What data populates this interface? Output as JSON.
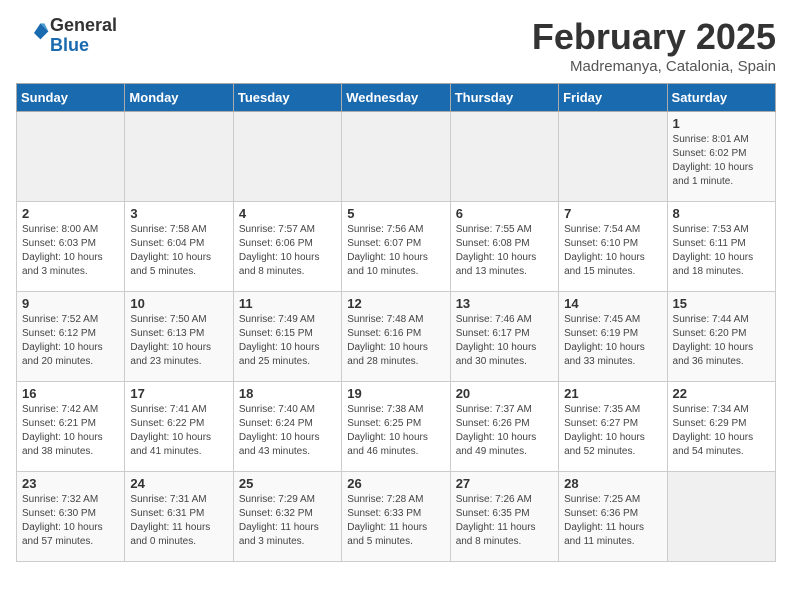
{
  "header": {
    "logo_line1": "General",
    "logo_line2": "Blue",
    "month_title": "February 2025",
    "location": "Madremanya, Catalonia, Spain"
  },
  "days_of_week": [
    "Sunday",
    "Monday",
    "Tuesday",
    "Wednesday",
    "Thursday",
    "Friday",
    "Saturday"
  ],
  "weeks": [
    [
      {
        "day": "",
        "info": ""
      },
      {
        "day": "",
        "info": ""
      },
      {
        "day": "",
        "info": ""
      },
      {
        "day": "",
        "info": ""
      },
      {
        "day": "",
        "info": ""
      },
      {
        "day": "",
        "info": ""
      },
      {
        "day": "1",
        "info": "Sunrise: 8:01 AM\nSunset: 6:02 PM\nDaylight: 10 hours\nand 1 minute."
      }
    ],
    [
      {
        "day": "2",
        "info": "Sunrise: 8:00 AM\nSunset: 6:03 PM\nDaylight: 10 hours\nand 3 minutes."
      },
      {
        "day": "3",
        "info": "Sunrise: 7:58 AM\nSunset: 6:04 PM\nDaylight: 10 hours\nand 5 minutes."
      },
      {
        "day": "4",
        "info": "Sunrise: 7:57 AM\nSunset: 6:06 PM\nDaylight: 10 hours\nand 8 minutes."
      },
      {
        "day": "5",
        "info": "Sunrise: 7:56 AM\nSunset: 6:07 PM\nDaylight: 10 hours\nand 10 minutes."
      },
      {
        "day": "6",
        "info": "Sunrise: 7:55 AM\nSunset: 6:08 PM\nDaylight: 10 hours\nand 13 minutes."
      },
      {
        "day": "7",
        "info": "Sunrise: 7:54 AM\nSunset: 6:10 PM\nDaylight: 10 hours\nand 15 minutes."
      },
      {
        "day": "8",
        "info": "Sunrise: 7:53 AM\nSunset: 6:11 PM\nDaylight: 10 hours\nand 18 minutes."
      }
    ],
    [
      {
        "day": "9",
        "info": "Sunrise: 7:52 AM\nSunset: 6:12 PM\nDaylight: 10 hours\nand 20 minutes."
      },
      {
        "day": "10",
        "info": "Sunrise: 7:50 AM\nSunset: 6:13 PM\nDaylight: 10 hours\nand 23 minutes."
      },
      {
        "day": "11",
        "info": "Sunrise: 7:49 AM\nSunset: 6:15 PM\nDaylight: 10 hours\nand 25 minutes."
      },
      {
        "day": "12",
        "info": "Sunrise: 7:48 AM\nSunset: 6:16 PM\nDaylight: 10 hours\nand 28 minutes."
      },
      {
        "day": "13",
        "info": "Sunrise: 7:46 AM\nSunset: 6:17 PM\nDaylight: 10 hours\nand 30 minutes."
      },
      {
        "day": "14",
        "info": "Sunrise: 7:45 AM\nSunset: 6:19 PM\nDaylight: 10 hours\nand 33 minutes."
      },
      {
        "day": "15",
        "info": "Sunrise: 7:44 AM\nSunset: 6:20 PM\nDaylight: 10 hours\nand 36 minutes."
      }
    ],
    [
      {
        "day": "16",
        "info": "Sunrise: 7:42 AM\nSunset: 6:21 PM\nDaylight: 10 hours\nand 38 minutes."
      },
      {
        "day": "17",
        "info": "Sunrise: 7:41 AM\nSunset: 6:22 PM\nDaylight: 10 hours\nand 41 minutes."
      },
      {
        "day": "18",
        "info": "Sunrise: 7:40 AM\nSunset: 6:24 PM\nDaylight: 10 hours\nand 43 minutes."
      },
      {
        "day": "19",
        "info": "Sunrise: 7:38 AM\nSunset: 6:25 PM\nDaylight: 10 hours\nand 46 minutes."
      },
      {
        "day": "20",
        "info": "Sunrise: 7:37 AM\nSunset: 6:26 PM\nDaylight: 10 hours\nand 49 minutes."
      },
      {
        "day": "21",
        "info": "Sunrise: 7:35 AM\nSunset: 6:27 PM\nDaylight: 10 hours\nand 52 minutes."
      },
      {
        "day": "22",
        "info": "Sunrise: 7:34 AM\nSunset: 6:29 PM\nDaylight: 10 hours\nand 54 minutes."
      }
    ],
    [
      {
        "day": "23",
        "info": "Sunrise: 7:32 AM\nSunset: 6:30 PM\nDaylight: 10 hours\nand 57 minutes."
      },
      {
        "day": "24",
        "info": "Sunrise: 7:31 AM\nSunset: 6:31 PM\nDaylight: 11 hours\nand 0 minutes."
      },
      {
        "day": "25",
        "info": "Sunrise: 7:29 AM\nSunset: 6:32 PM\nDaylight: 11 hours\nand 3 minutes."
      },
      {
        "day": "26",
        "info": "Sunrise: 7:28 AM\nSunset: 6:33 PM\nDaylight: 11 hours\nand 5 minutes."
      },
      {
        "day": "27",
        "info": "Sunrise: 7:26 AM\nSunset: 6:35 PM\nDaylight: 11 hours\nand 8 minutes."
      },
      {
        "day": "28",
        "info": "Sunrise: 7:25 AM\nSunset: 6:36 PM\nDaylight: 11 hours\nand 11 minutes."
      },
      {
        "day": "",
        "info": ""
      }
    ]
  ]
}
